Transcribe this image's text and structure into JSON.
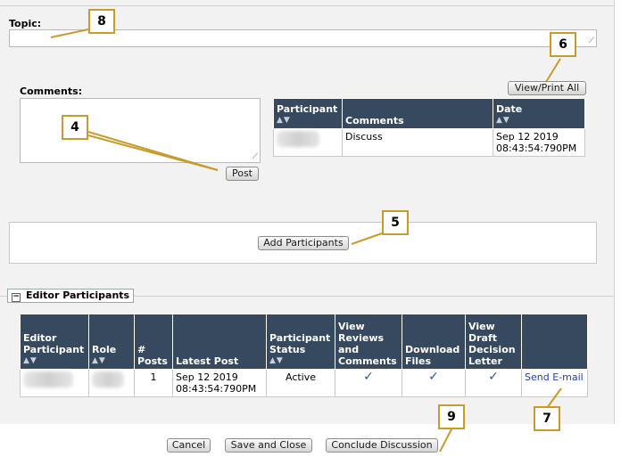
{
  "topic": {
    "label": "Topic:",
    "value": ""
  },
  "comments": {
    "label": "Comments:",
    "value": "",
    "post_label": "Post"
  },
  "view_print_all_label": "View/Print All",
  "discussion_table": {
    "headers": {
      "participant": "Participant",
      "comments": "Comments",
      "date": "Date"
    },
    "rows": [
      {
        "participant": "",
        "comments": "Discuss",
        "date_line1": "Sep 12 2019",
        "date_line2": "08:43:54:790PM"
      }
    ]
  },
  "add_participants_label": "Add Participants",
  "editor_participants": {
    "title": "Editor Participants",
    "headers": {
      "editor_participant_1": "Editor",
      "editor_participant_2": "Participant",
      "role": "Role",
      "posts_1": "#",
      "posts_2": "Posts",
      "latest_post": "Latest Post",
      "status_1": "Participant",
      "status_2": "Status",
      "view_reviews_1": "View",
      "view_reviews_2": "Reviews",
      "view_reviews_3": "and",
      "view_reviews_4": "Comments",
      "download_1": "Download",
      "download_2": "Files",
      "view_draft_1": "View",
      "view_draft_2": "Draft",
      "view_draft_3": "Decision",
      "view_draft_4": "Letter"
    },
    "rows": [
      {
        "posts": "1",
        "latest_line1": "Sep 12 2019",
        "latest_line2": "08:43:54:790PM",
        "status": "Active",
        "send_email": "Send E-mail"
      }
    ]
  },
  "footer": {
    "cancel": "Cancel",
    "save_close": "Save and Close",
    "conclude": "Conclude Discussion"
  },
  "callouts": {
    "c4": "4",
    "c5": "5",
    "c6": "6",
    "c7": "7",
    "c8": "8",
    "c9": "9"
  },
  "icons": {
    "checkmark": "checkmark-icon",
    "sort": "sort-arrows-icon",
    "collapse": "collapse-toggle-icon"
  },
  "colors": {
    "table_header": "#36495e",
    "callout_border": "#c89b2c",
    "link": "#1d3fb5"
  }
}
